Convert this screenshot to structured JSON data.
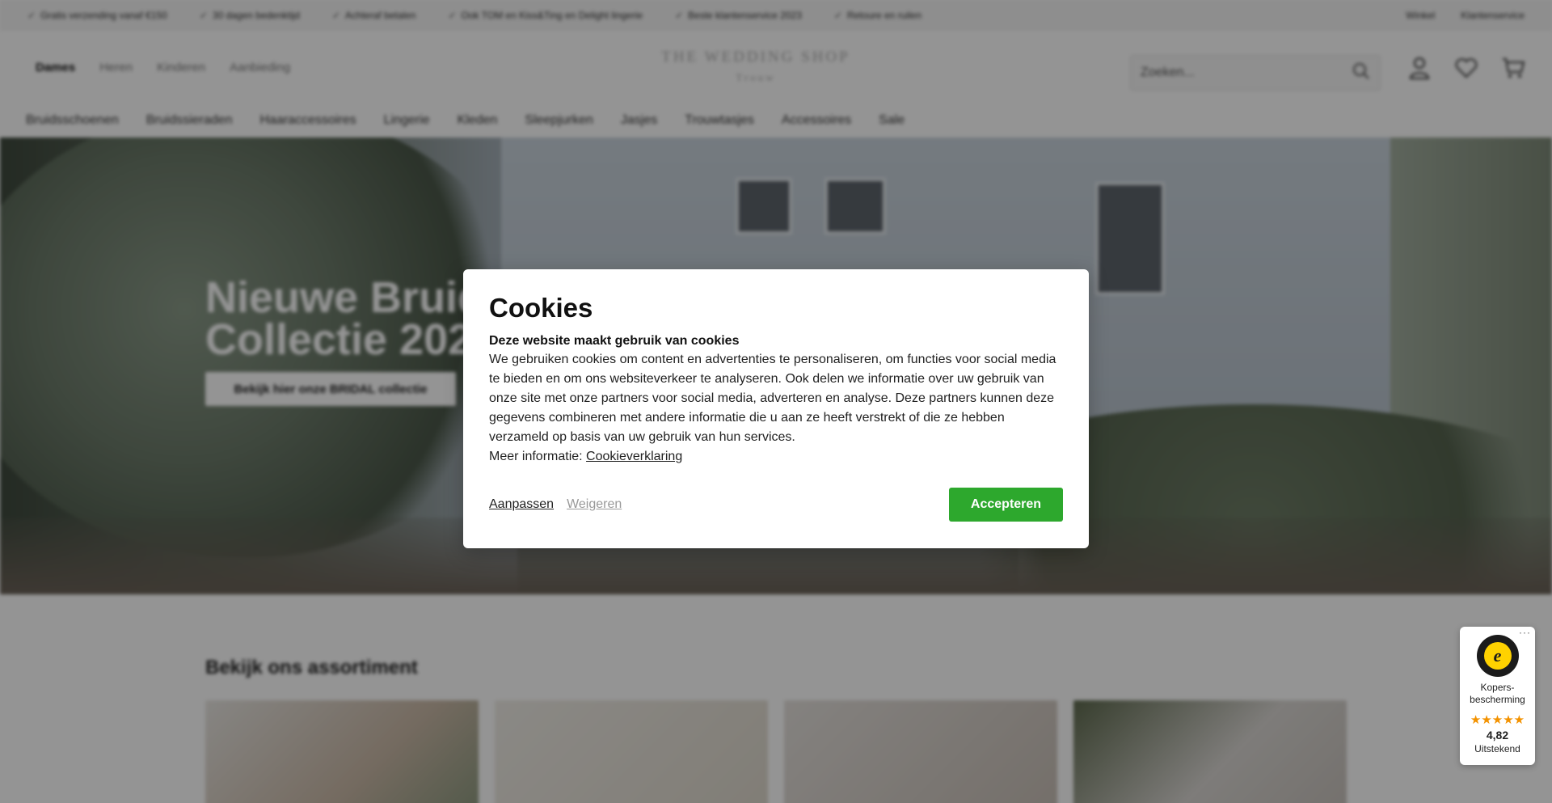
{
  "topbar": {
    "usps": [
      "Gratis verzending vanaf €150",
      "30 dagen bedenktijd",
      "Achteraf betalen",
      "Ook TOM en Kiss&Ting en Delight lingerie",
      "Beste klantenservice 2023",
      "Retoure en ruilen"
    ],
    "links": [
      "Winkel",
      "Klantenservice"
    ]
  },
  "header": {
    "gender_tabs": [
      "Dames",
      "Heren",
      "Kinderen",
      "Aanbieding"
    ],
    "active_gender": "Dames",
    "logo_line1": "THE WEDDING SHOP",
    "logo_line2": "Trouw",
    "search_placeholder": "Zoeken...",
    "icons": [
      "account-icon",
      "heart-icon",
      "cart-icon"
    ]
  },
  "nav": {
    "items": [
      "Bruidsschoenen",
      "Bruidssieraden",
      "Haaraccessoires",
      "Lingerie",
      "Kleden",
      "Sleepjurken",
      "Jasjes",
      "Trouwtasjes",
      "Accessoires",
      "Sale"
    ]
  },
  "hero": {
    "title_line1": "Nieuwe Bruids",
    "title_line2": "Collectie 2023",
    "button_label": "Bekijk hier onze BRIDAL collectie"
  },
  "assortment": {
    "title": "Bekijk ons assortiment"
  },
  "cookie_modal": {
    "title": "Cookies",
    "subtitle": "Deze website maakt gebruik van cookies",
    "body": "We gebruiken cookies om content en advertenties te personaliseren, om functies voor social media te bieden en om ons websiteverkeer te analyseren. Ook delen we informatie over uw gebruik van onze site met onze partners voor social media, adverteren en analyse. Deze partners kunnen deze gegevens combineren met andere informatie die u aan ze heeft verstrekt of die ze hebben verzameld op basis van uw gebruik van hun services.",
    "more_prefix": "Meer informatie:",
    "more_link": "Cookieverklaring",
    "customize_label": "Aanpassen",
    "decline_label": "Weigeren",
    "accept_label": "Accepteren",
    "accept_color": "#2da82d"
  },
  "trust_badge": {
    "menu": "···",
    "seal_letter": "e",
    "label_line1": "Kopers-",
    "label_line2": "bescherming",
    "stars": "★★★★★",
    "score": "4,82",
    "verdict": "Uitstekend"
  }
}
